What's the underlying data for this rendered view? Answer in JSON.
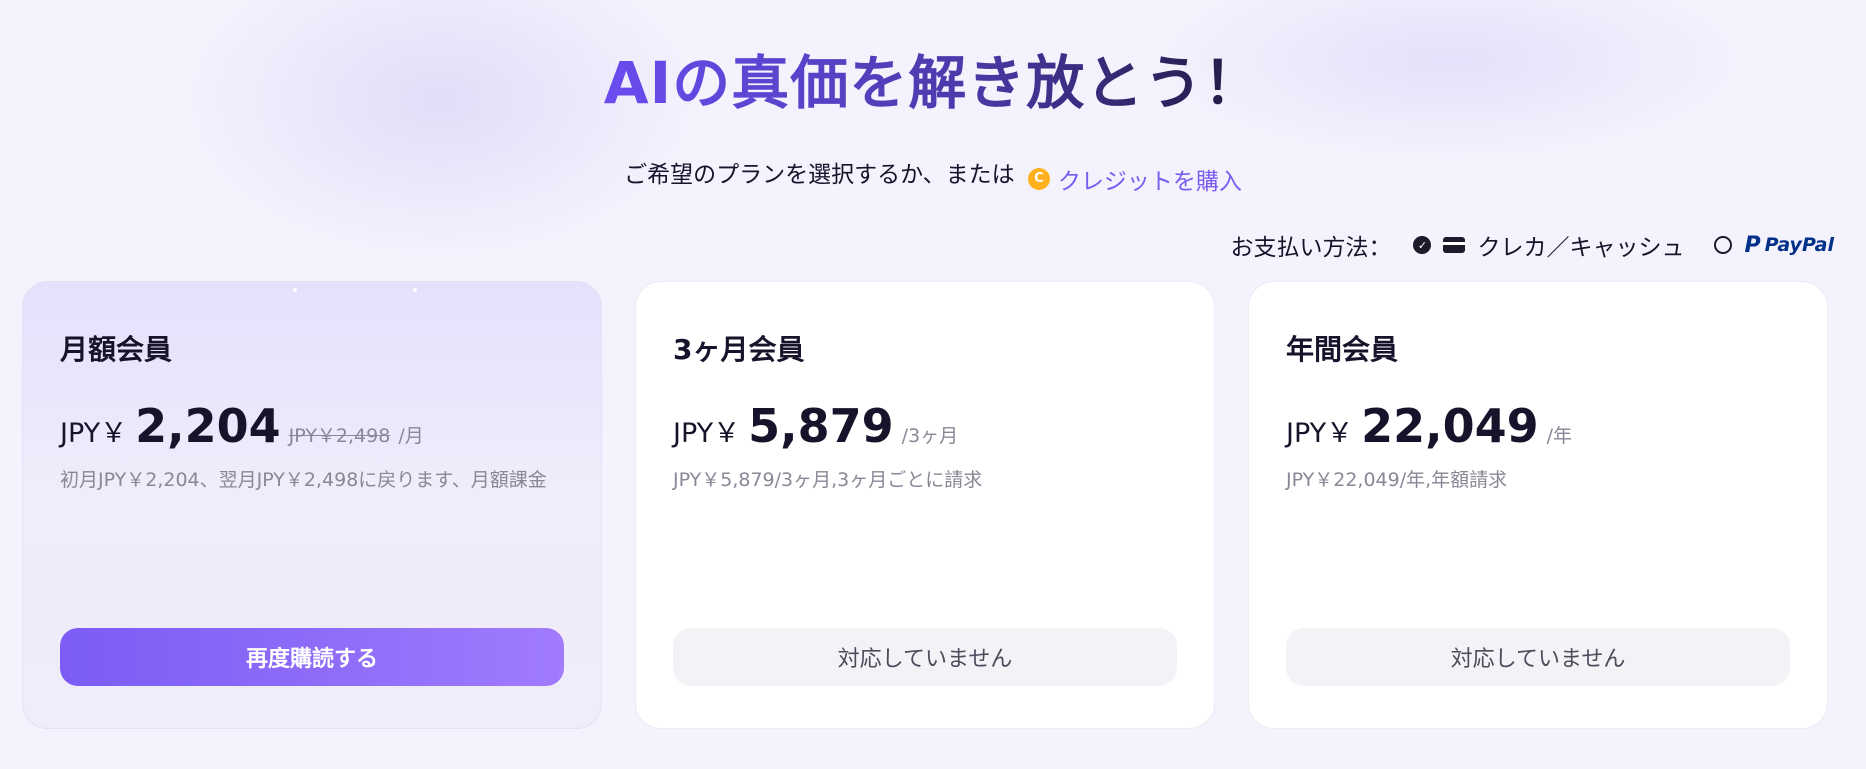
{
  "header": {
    "title": "AIの真価を解き放とう！",
    "subtitle": "ご希望のプランを選択するか、または",
    "credit_link": "クレジットを購入"
  },
  "payment": {
    "label": "お支払い方法：",
    "options": [
      {
        "label": "クレカ／キャッシュ",
        "selected": true
      },
      {
        "label": "PayPal",
        "selected": false
      }
    ]
  },
  "plans": [
    {
      "name": "月額会員",
      "currency": "JPY￥",
      "price": "2,204",
      "original_price": "JPY￥2,498",
      "period": "/月",
      "description": "初月JPY￥2,204、翌月JPY￥2,498に戻ります、月額課金",
      "button": "再度購読する",
      "active": true
    },
    {
      "name": "3ヶ月会員",
      "currency": "JPY￥",
      "price": "5,879",
      "period": "/3ヶ月",
      "description": "JPY￥5,879/3ヶ月,3ヶ月ごとに請求",
      "button": "対応していません",
      "active": false
    },
    {
      "name": "年間会員",
      "currency": "JPY￥",
      "price": "22,049",
      "period": "/年",
      "description": "JPY￥22,049/年,年額請求",
      "button": "対応していません",
      "active": false
    }
  ],
  "colors": {
    "accent": "#7a5df0",
    "button_gradient_start": "#7b5cf5",
    "button_gradient_end": "#a07bfc",
    "coin": "#ffb21e",
    "paypal_dark": "#003087",
    "paypal_light": "#0070e0"
  }
}
